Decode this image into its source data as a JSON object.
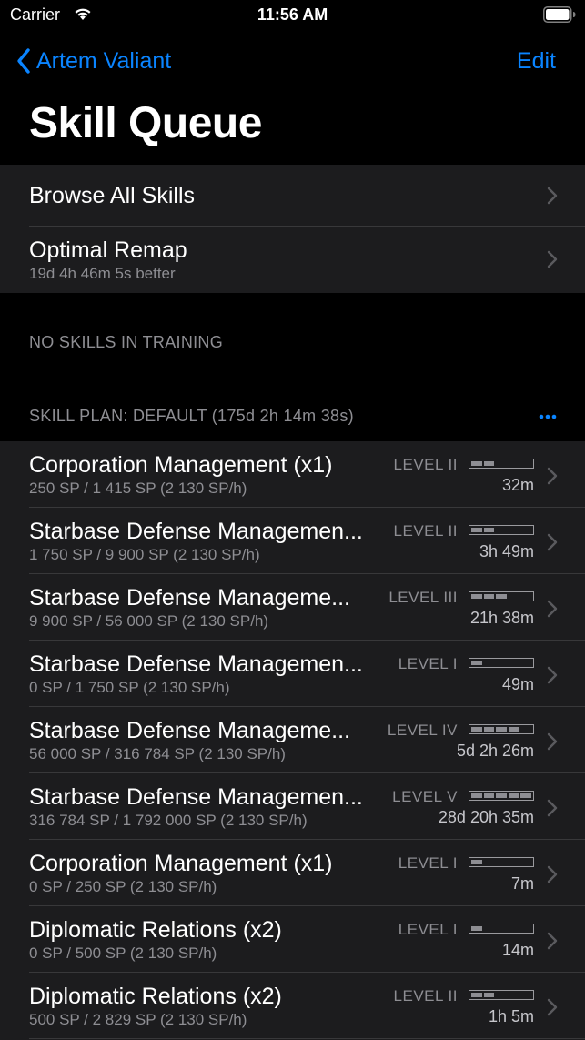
{
  "status_bar": {
    "carrier": "Carrier",
    "time": "11:56 AM"
  },
  "nav": {
    "back_label": "Artem Valiant",
    "edit_label": "Edit",
    "title": "Skill Queue"
  },
  "menu": {
    "browse_label": "Browse All Skills",
    "remap_label": "Optimal Remap",
    "remap_sub": "19d 4h 46m 5s better"
  },
  "training_header": "NO SKILLS IN TRAINING",
  "plan_header": "SKILL PLAN: DEFAULT (175d 2h 14m 38s)",
  "colors": {
    "accent": "#0a84ff",
    "background": "#000000",
    "cell_background": "#1c1c1e",
    "secondary_text": "#8e8e93"
  },
  "skills": [
    {
      "title": "Corporation Management (x1)",
      "sp": "250 SP / 1 415 SP (2 130 SP/h)",
      "level_label": "LEVEL II",
      "level": 2,
      "time": "32m"
    },
    {
      "title": "Starbase Defense Managemen...",
      "sp": "1 750 SP / 9 900 SP (2 130 SP/h)",
      "level_label": "LEVEL II",
      "level": 2,
      "time": "3h 49m"
    },
    {
      "title": "Starbase Defense Manageme...",
      "sp": "9 900 SP / 56 000 SP (2 130 SP/h)",
      "level_label": "LEVEL III",
      "level": 3,
      "time": "21h 38m"
    },
    {
      "title": "Starbase Defense Managemen...",
      "sp": "0 SP / 1 750 SP (2 130 SP/h)",
      "level_label": "LEVEL I",
      "level": 1,
      "time": "49m"
    },
    {
      "title": "Starbase Defense Manageme...",
      "sp": "56 000 SP / 316 784 SP (2 130 SP/h)",
      "level_label": "LEVEL IV",
      "level": 4,
      "time": "5d 2h 26m"
    },
    {
      "title": "Starbase Defense Managemen...",
      "sp": "316 784 SP / 1 792 000 SP (2 130 SP/h)",
      "level_label": "LEVEL V",
      "level": 5,
      "time": "28d 20h 35m"
    },
    {
      "title": "Corporation Management (x1)",
      "sp": "0 SP / 250 SP (2 130 SP/h)",
      "level_label": "LEVEL I",
      "level": 1,
      "time": "7m"
    },
    {
      "title": "Diplomatic Relations (x2)",
      "sp": "0 SP / 500 SP (2 130 SP/h)",
      "level_label": "LEVEL I",
      "level": 1,
      "time": "14m"
    },
    {
      "title": "Diplomatic Relations (x2)",
      "sp": "500 SP / 2 829 SP (2 130 SP/h)",
      "level_label": "LEVEL II",
      "level": 2,
      "time": "1h 5m"
    }
  ]
}
